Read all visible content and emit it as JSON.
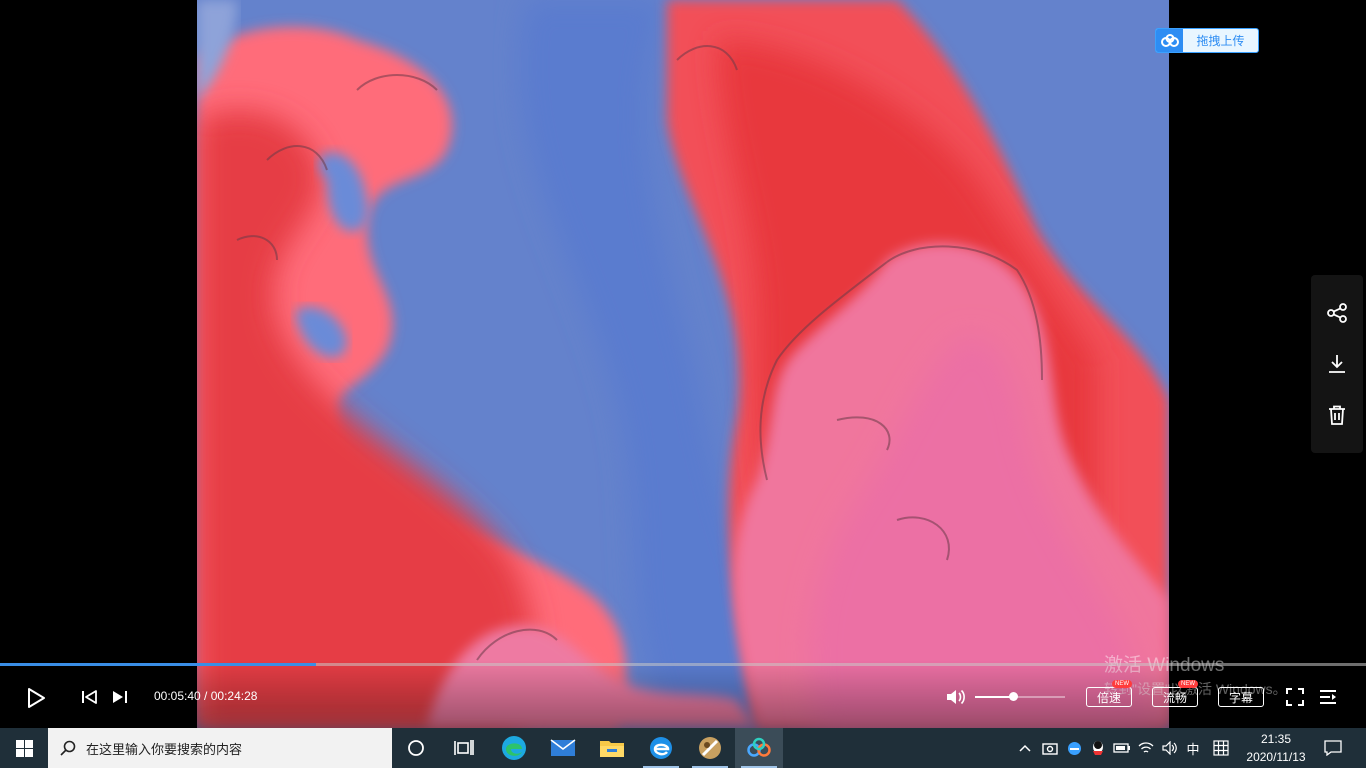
{
  "player": {
    "upload_label": "拖拽上传",
    "side_actions": [
      {
        "icon": "share-icon"
      },
      {
        "icon": "download-icon"
      },
      {
        "icon": "trash-icon"
      }
    ],
    "watermark": {
      "line1": "激活 Windows",
      "line2": "转到\"设置\"以激活 Windows。"
    }
  },
  "controls": {
    "current_time": "00:05:40",
    "total_time": "00:24:28",
    "time_separator": " / ",
    "progress_fraction": 0.2316,
    "volume_fraction": 0.42,
    "speed_label": "倍速",
    "quality_label": "流畅",
    "subtitle_label": "字幕",
    "new_badge": "NEW",
    "accent_color": "#3a8ee6"
  },
  "taskbar": {
    "search_placeholder": "在这里输入你要搜索的内容",
    "apps": [
      {
        "icon": "cortana-icon"
      },
      {
        "icon": "task-view-icon"
      },
      {
        "icon": "edge-icon"
      },
      {
        "icon": "mail-icon"
      },
      {
        "icon": "file-explorer-icon"
      },
      {
        "icon": "ie-icon"
      },
      {
        "icon": "media-app-icon"
      },
      {
        "icon": "baidu-netdisk-icon"
      }
    ],
    "ime_label": "中",
    "clock_time": "21:35",
    "clock_date": "2020/11/13"
  }
}
